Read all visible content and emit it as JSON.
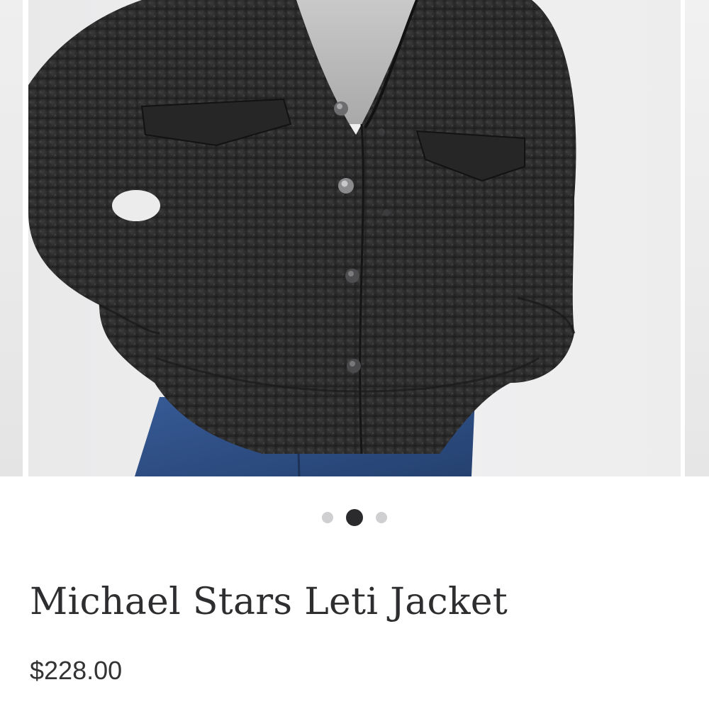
{
  "product": {
    "title": "Michael Stars Leti Jacket",
    "price": "$228.00",
    "image_subject": "black boucle snap-front jacket with flap chest pockets worn over a grey turtleneck and blue jeans"
  },
  "carousel": {
    "slide_count": 3,
    "active_index": 1
  },
  "colors": {
    "jacket": "#2a2a2a",
    "background": "#ededee",
    "denim": "#2f4f86",
    "dot_active": "#2b2b2d",
    "dot_inactive": "#cfcfd1",
    "text": "#2e2e30"
  }
}
